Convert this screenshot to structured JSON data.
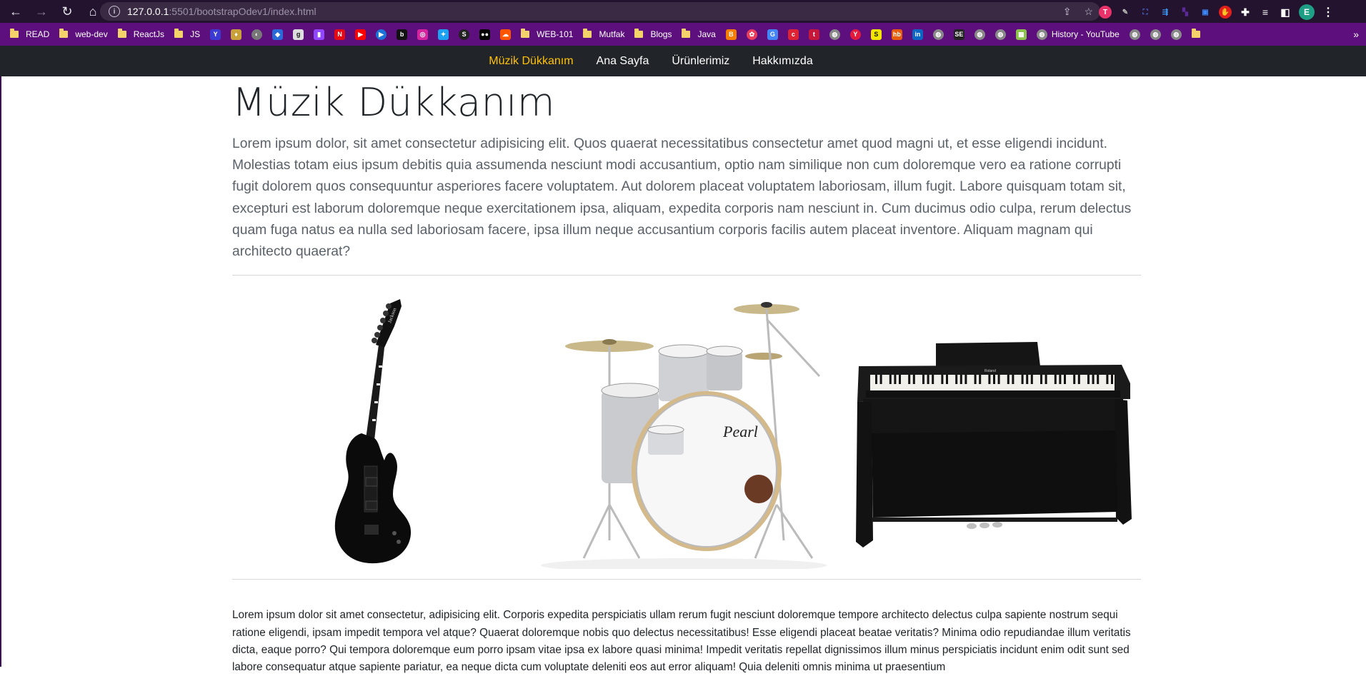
{
  "browser": {
    "url_host": "127.0.0.1",
    "url_path": ":5501/bootstrapOdev1/index.html",
    "profile_initial": "E",
    "bookmarks": [
      {
        "type": "folder",
        "label": "READ"
      },
      {
        "type": "folder",
        "label": "web-dev"
      },
      {
        "type": "folder",
        "label": "ReactJs"
      },
      {
        "type": "folder",
        "label": "JS"
      },
      {
        "type": "fav",
        "label": "",
        "color": "#3b3bd4",
        "glyph": "Y"
      },
      {
        "type": "fav",
        "label": "",
        "color": "#c9a13b",
        "glyph": "♦"
      },
      {
        "type": "fav",
        "label": "",
        "color": "#777",
        "glyph": "◐",
        "round": true
      },
      {
        "type": "fav",
        "label": "",
        "color": "#2a6ad8",
        "glyph": "◆"
      },
      {
        "type": "fav",
        "label": "",
        "color": "#ddd",
        "glyph": "g",
        "dark": true
      },
      {
        "type": "fav",
        "label": "",
        "color": "#9146ff",
        "glyph": "▮"
      },
      {
        "type": "fav",
        "label": "",
        "color": "#e50914",
        "glyph": "N"
      },
      {
        "type": "fav",
        "label": "",
        "color": "#ff0000",
        "glyph": "▶"
      },
      {
        "type": "fav",
        "label": "",
        "color": "#1d72d8",
        "glyph": "▶",
        "round": true
      },
      {
        "type": "fav",
        "label": "",
        "color": "#111",
        "glyph": "b"
      },
      {
        "type": "fav",
        "label": "",
        "color": "#d6249f",
        "glyph": "◎"
      },
      {
        "type": "fav",
        "label": "",
        "color": "#1da1f2",
        "glyph": "✦"
      },
      {
        "type": "fav",
        "label": "",
        "color": "#222",
        "glyph": "S",
        "round": true
      },
      {
        "type": "fav",
        "label": "",
        "color": "#000",
        "glyph": "●●"
      },
      {
        "type": "fav",
        "label": "",
        "color": "#ff5500",
        "glyph": "☁"
      },
      {
        "type": "folder",
        "label": "WEB-101"
      },
      {
        "type": "folder",
        "label": "Mutfak"
      },
      {
        "type": "folder",
        "label": "Blogs"
      },
      {
        "type": "folder",
        "label": "Java"
      },
      {
        "type": "fav",
        "label": "",
        "color": "#f57d00",
        "glyph": "B"
      },
      {
        "type": "fav",
        "label": "",
        "color": "#e93e5b",
        "glyph": "✿",
        "round": true
      },
      {
        "type": "fav",
        "label": "",
        "color": "#4285f4",
        "glyph": "G"
      },
      {
        "type": "fav",
        "label": "",
        "color": "#d23",
        "glyph": "c"
      },
      {
        "type": "fav",
        "label": "",
        "color": "#c4173a",
        "glyph": "t"
      },
      {
        "type": "fav",
        "label": "",
        "color": "#888",
        "glyph": "◍",
        "round": true
      },
      {
        "type": "fav",
        "label": "",
        "color": "#e21b3c",
        "glyph": "Y",
        "round": true
      },
      {
        "type": "fav",
        "label": "",
        "color": "#f2e600",
        "glyph": "S",
        "dark": true
      },
      {
        "type": "fav",
        "label": "",
        "color": "#e85d0c",
        "glyph": "hb"
      },
      {
        "type": "fav",
        "label": "",
        "color": "#0a66c2",
        "glyph": "in"
      },
      {
        "type": "fav",
        "label": "",
        "color": "#888",
        "glyph": "◍",
        "round": true
      },
      {
        "type": "fav",
        "label": "",
        "color": "#222",
        "glyph": "SE"
      },
      {
        "type": "fav",
        "label": "",
        "color": "#888",
        "glyph": "◍",
        "round": true
      },
      {
        "type": "fav",
        "label": "",
        "color": "#888",
        "glyph": "◍",
        "round": true
      },
      {
        "type": "fav",
        "label": "",
        "color": "#8bc34a",
        "glyph": "▦"
      },
      {
        "type": "favlabel",
        "label": "History - YouTube",
        "color": "#888",
        "glyph": "◍",
        "round": true
      },
      {
        "type": "fav",
        "label": "",
        "color": "#888",
        "glyph": "◍",
        "round": true
      },
      {
        "type": "fav",
        "label": "",
        "color": "#888",
        "glyph": "◍",
        "round": true
      },
      {
        "type": "fav",
        "label": "",
        "color": "#888",
        "glyph": "◍",
        "round": true
      },
      {
        "type": "folder",
        "label": ""
      }
    ]
  },
  "navbar": {
    "brand": "Müzik Dükkanım",
    "links": [
      "Ana Sayfa",
      "Ürünlerimiz",
      "Hakkımızda"
    ]
  },
  "page": {
    "title": "Müzik Dükkanım",
    "lead": "Lorem ipsum dolor, sit amet consectetur adipisicing elit. Quos quaerat necessitatibus consectetur amet quod magni ut, et esse eligendi incidunt. Molestias totam eius ipsum debitis quia assumenda nesciunt modi accusantium, optio nam similique non cum doloremque vero ea ratione corrupti fugit dolorem quos consequuntur asperiores facere voluptatem. Aut dolorem placeat voluptatem laboriosam, illum fugit. Labore quisquam totam sit, excepturi est laborum doloremque neque exercitationem ipsa, aliquam, expedita corporis nam nesciunt in. Cum ducimus odio culpa, rerum delectus quam fuga natus ea nulla sed laboriosam facere, ipsa illum neque accusantium corporis facilis autem placeat inventore. Aliquam magnam qui architecto quaerat?",
    "images": [
      "guitar-image",
      "drum-kit-image",
      "piano-image"
    ],
    "drum_brand": "Pearl",
    "body": "Lorem ipsum dolor sit amet consectetur, adipisicing elit. Corporis expedita perspiciatis ullam rerum fugit nesciunt doloremque tempore architecto delectus culpa sapiente nostrum sequi ratione eligendi, ipsam impedit tempora vel atque? Quaerat doloremque nobis quo delectus necessitatibus! Esse eligendi placeat beatae veritatis? Minima odio repudiandae illum veritatis dicta, eaque porro? Qui tempora doloremque eum porro ipsam vitae ipsa ex labore quasi minima! Impedit veritatis repellat dignissimos illum minus perspiciatis incidunt enim odit sunt sed labore consequatur atque sapiente pariatur, ea neque dicta cum voluptate deleniti eos aut error aliquam! Quia deleniti omnis minima ut praesentium"
  },
  "colors": {
    "toolbar": "#24132e",
    "bookmarks_bar": "#5c0f7d",
    "navbar": "#212529",
    "brand": "#ffc107"
  }
}
